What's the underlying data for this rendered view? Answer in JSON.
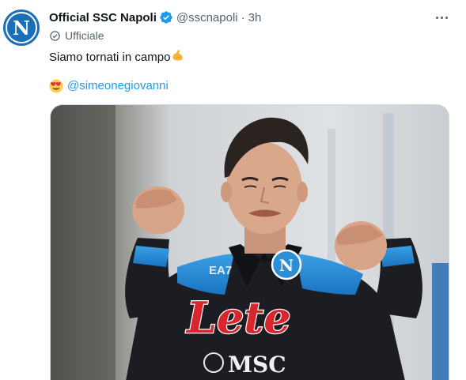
{
  "tweet": {
    "display_name": "Official SSC Napoli",
    "handle": "@sscnapoli",
    "separator": "·",
    "time": "3h",
    "label": "Ufficiale",
    "text": "Siamo tornati in campo",
    "mention": "@simeonegiovanni"
  },
  "avatar": {
    "letter": "N"
  },
  "media": {
    "crest_letter": "N",
    "sponsor": "Lete",
    "sponsor_secondary": "MSC",
    "kit_brand": "EA7"
  },
  "icons": {
    "verified": "verified-badge-icon",
    "label": "check-circle-icon",
    "more": "more-dots-icon",
    "muscle": "flexed-biceps-emoji",
    "face": "heart-eyes-emoji"
  },
  "colors": {
    "accent": "#1d9bf0",
    "secondary_text": "#536471",
    "napoli_blue": "#1b6fb8",
    "kit_black": "#1b1d22",
    "kit_sky": "#2a8fd6",
    "lete_red": "#d8262c"
  }
}
